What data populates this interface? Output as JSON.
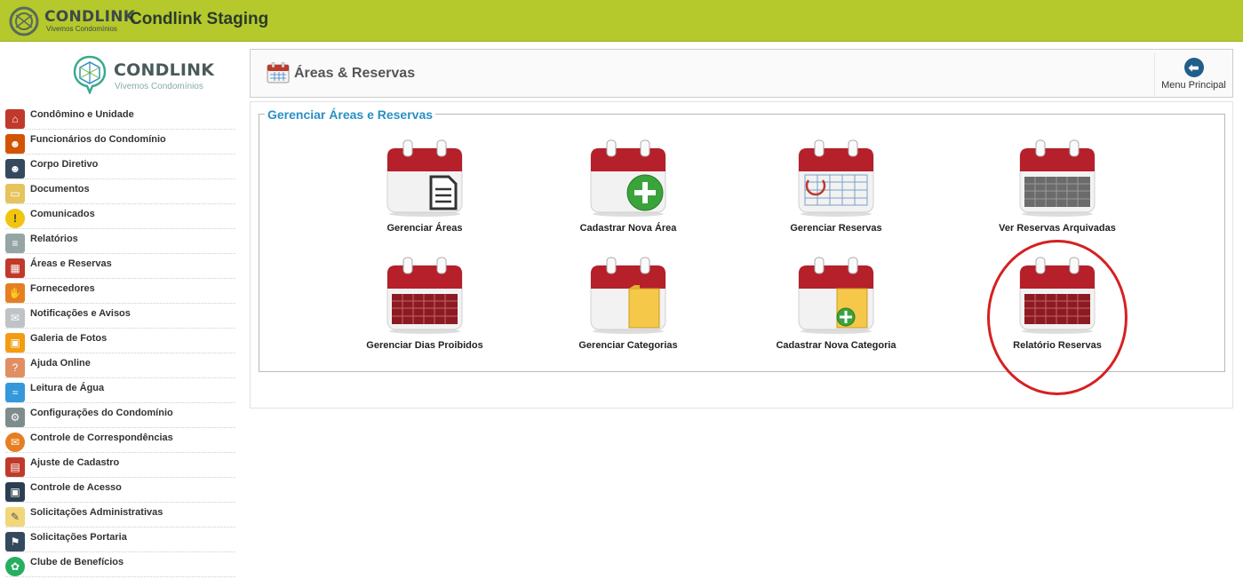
{
  "topbar": {
    "brand": "CONDLINK",
    "tagline": "Vivemos Condomínios",
    "app_title": "Condlink Staging",
    "color": "#b5c92c"
  },
  "sidebar": {
    "logo_brand": "CONDLINK",
    "logo_tagline": "Vivemos Condomínios",
    "items": [
      {
        "label": "Condômino e Unidade",
        "icon": "person-house-icon",
        "color": "#c0392b"
      },
      {
        "label": "Funcionários do Condomínio",
        "icon": "staff-icon",
        "color": "#d35400"
      },
      {
        "label": "Corpo Diretivo",
        "icon": "board-icon",
        "color": "#34495e"
      },
      {
        "label": "Documentos",
        "icon": "folder-icon",
        "color": "#e6c35c"
      },
      {
        "label": "Comunicados",
        "icon": "warning-icon",
        "color": "#f1c40f"
      },
      {
        "label": "Relatórios",
        "icon": "report-icon",
        "color": "#95a5a6"
      },
      {
        "label": "Áreas e Reservas",
        "icon": "calendar-icon",
        "color": "#c0392b"
      },
      {
        "label": "Fornecedores",
        "icon": "handshake-icon",
        "color": "#e67e22"
      },
      {
        "label": "Notificações e Avisos",
        "icon": "notice-icon",
        "color": "#bdc3c7"
      },
      {
        "label": "Galeria de Fotos",
        "icon": "photos-icon",
        "color": "#f39c12"
      },
      {
        "label": "Ajuda Online",
        "icon": "help-icon",
        "color": "#e08f62"
      },
      {
        "label": "Leitura de Água",
        "icon": "water-icon",
        "color": "#3498db"
      },
      {
        "label": "Configurações do Condomínio",
        "icon": "settings-icon",
        "color": "#7f8c8d"
      },
      {
        "label": "Controle de Correspondências",
        "icon": "mail-icon",
        "color": "#e67e22"
      },
      {
        "label": "Ajuste de Cadastro",
        "icon": "register-icon",
        "color": "#c0392b"
      },
      {
        "label": "Controle de Acesso",
        "icon": "access-icon",
        "color": "#2c3e50"
      },
      {
        "label": "Solicitações Administrativas",
        "icon": "request-icon",
        "color": "#f1d77a"
      },
      {
        "label": "Solicitações Portaria",
        "icon": "gate-icon",
        "color": "#34495e"
      },
      {
        "label": "Clube de Benefícios",
        "icon": "club-icon",
        "color": "#27ae60"
      }
    ]
  },
  "header": {
    "title": "Áreas & Reservas",
    "back_label": "Menu Principal"
  },
  "panel": {
    "legend": "Gerenciar Áreas e Reservas",
    "tiles": [
      {
        "label": "Gerenciar Áreas",
        "icon": "calendar-document-icon"
      },
      {
        "label": "Cadastrar Nova Área",
        "icon": "calendar-add-icon"
      },
      {
        "label": "Gerenciar Reservas",
        "icon": "calendar-grid-icon"
      },
      {
        "label": "Ver Reservas Arquivadas",
        "icon": "calendar-archived-icon"
      },
      {
        "label": "Gerenciar Dias Proibidos",
        "icon": "calendar-blocked-icon"
      },
      {
        "label": "Gerenciar Categorias",
        "icon": "calendar-folder-icon"
      },
      {
        "label": "Cadastrar Nova Categoria",
        "icon": "calendar-folder-add-icon"
      },
      {
        "label": "Relatório Reservas",
        "icon": "calendar-report-icon"
      }
    ]
  }
}
